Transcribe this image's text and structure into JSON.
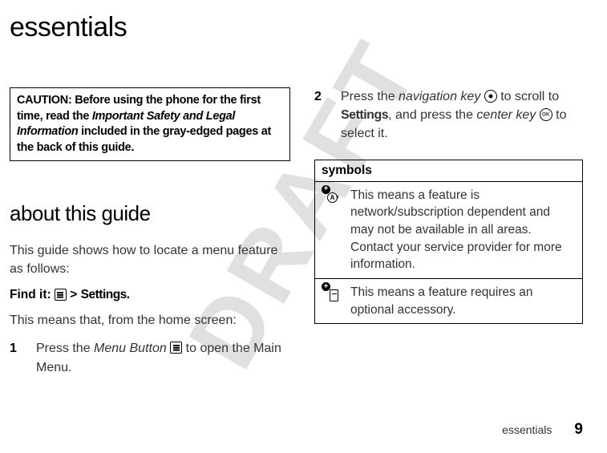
{
  "page_title": "essentials",
  "watermark": "DRAFT",
  "caution_box": {
    "prefix": "CAUTION: Before using the phone for the first time, read the ",
    "italic": "Important Safety and Legal Information",
    "suffix": " included in the gray-edged pages at the back of this guide."
  },
  "section_heading": "about this guide",
  "intro_text": "This guide shows how to locate a menu feature as follows:",
  "find_it": {
    "label": "Find it:",
    "chevron": ">",
    "target": "Settings."
  },
  "this_means": "This means that, from the home screen:",
  "steps": {
    "1": {
      "num": "1",
      "pre": "Press the ",
      "italic": "Menu Button",
      "post": " to open the Main Menu."
    },
    "2": {
      "num": "2",
      "pre": "Press the ",
      "italic1": "navigation key",
      "mid1": " to scroll to ",
      "bold": "Settings",
      "mid2": ", and press the ",
      "italic2": "center key",
      "post": " to select it."
    }
  },
  "symbols": {
    "header": "symbols",
    "rows": [
      {
        "text": "This means a feature is network/subscription dependent and may not be available in all areas. Contact your service provider for more information."
      },
      {
        "text": "This means a feature requires an optional accessory."
      }
    ]
  },
  "footer": {
    "label": "essentials",
    "page_num": "9"
  }
}
